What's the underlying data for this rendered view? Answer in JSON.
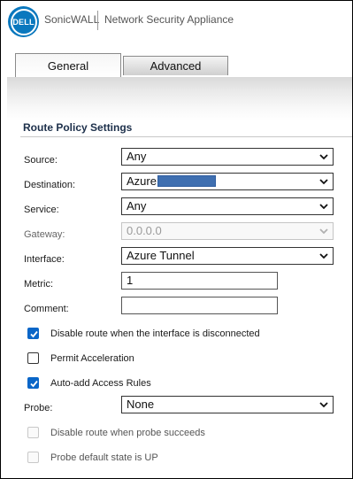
{
  "header": {
    "logo_text": "DELL",
    "brand": "SonicWALL",
    "product": "Network Security Appliance"
  },
  "tabs": [
    {
      "label": "General",
      "active": true
    },
    {
      "label": "Advanced",
      "active": false
    }
  ],
  "section": {
    "title": "Route Policy Settings"
  },
  "fields": {
    "source": {
      "label": "Source:",
      "value": "Any"
    },
    "destination": {
      "label": "Destination:",
      "value": "Azure"
    },
    "service": {
      "label": "Service:",
      "value": "Any"
    },
    "gateway": {
      "label": "Gateway:",
      "value": "0.0.0.0",
      "disabled": true
    },
    "interface": {
      "label": "Interface:",
      "value": "Azure Tunnel"
    },
    "metric": {
      "label": "Metric:",
      "value": "1"
    },
    "comment": {
      "label": "Comment:",
      "value": ""
    },
    "probe": {
      "label": "Probe:",
      "value": "None"
    }
  },
  "checkboxes": {
    "disable_route": {
      "label": "Disable route when the interface is disconnected",
      "checked": true
    },
    "permit_accel": {
      "label": "Permit Acceleration",
      "checked": false
    },
    "auto_add": {
      "label": "Auto-add Access Rules",
      "checked": true
    },
    "disable_probe": {
      "label": "Disable route when probe succeeds",
      "checked": false,
      "disabled": true
    },
    "probe_default": {
      "label": "Probe default state is UP",
      "checked": false,
      "disabled": true
    }
  },
  "colors": {
    "checkbox_checked": "#0a66c8",
    "logo": "#0a78be",
    "redaction": "#3f6fb0"
  }
}
